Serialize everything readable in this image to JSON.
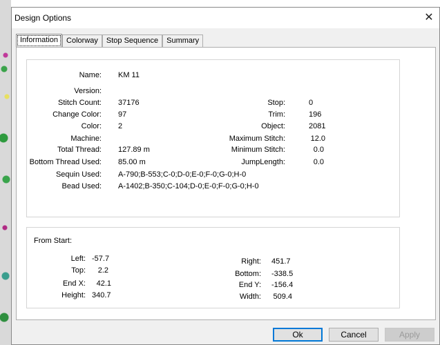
{
  "window": {
    "title": "Design Options"
  },
  "tabs": [
    "Information",
    "Colorway",
    "Stop Sequence",
    "Summary"
  ],
  "info": {
    "name_label": "Name:",
    "name": "KM 11",
    "version_label": "Version:",
    "version": "",
    "stitch_count_label": "Stitch Count:",
    "stitch_count": "37176",
    "change_color_label": "Change Color:",
    "change_color": "97",
    "color_label": "Color:",
    "color": "2",
    "machine_label": "Machine:",
    "machine": "",
    "total_thread_label": "Total Thread:",
    "total_thread": "127.89 m",
    "bottom_thread_label": "Bottom Thread Used:",
    "bottom_thread": "85.00 m",
    "sequin_label": "Sequin Used:",
    "sequin": "A-790;B-553;C-0;D-0;E-0;F-0;G-0;H-0",
    "bead_label": "Bead Used:",
    "bead": "A-1402;B-350;C-104;D-0;E-0;F-0;G-0;H-0",
    "stop_label": "Stop:",
    "stop": "0",
    "trim_label": "Trim:",
    "trim": "196",
    "object_label": "Object:",
    "object": "2081",
    "max_stitch_label": "Maximum Stitch:",
    "max_stitch": "12.0",
    "min_stitch_label": "Minimum Stitch:",
    "min_stitch": "0.0",
    "jump_length_label": "JumpLength:",
    "jump_length": "0.0"
  },
  "from_start": {
    "heading": "From Start:",
    "left_label": "Left:",
    "left": "-57.7",
    "top_label": "Top:",
    "top": "2.2",
    "end_x_label": "End X:",
    "end_x": "42.1",
    "height_label": "Height:",
    "height": "340.7",
    "right_label": "Right:",
    "right": "451.7",
    "bottom_label": "Bottom:",
    "bottom": "-338.5",
    "end_y_label": "End Y:",
    "end_y": "-156.4",
    "width_label": "Width:",
    "width": "509.4"
  },
  "buttons": {
    "ok": "Ok",
    "cancel": "Cancel",
    "apply": "Apply"
  },
  "icons": {
    "close": "close-icon"
  }
}
